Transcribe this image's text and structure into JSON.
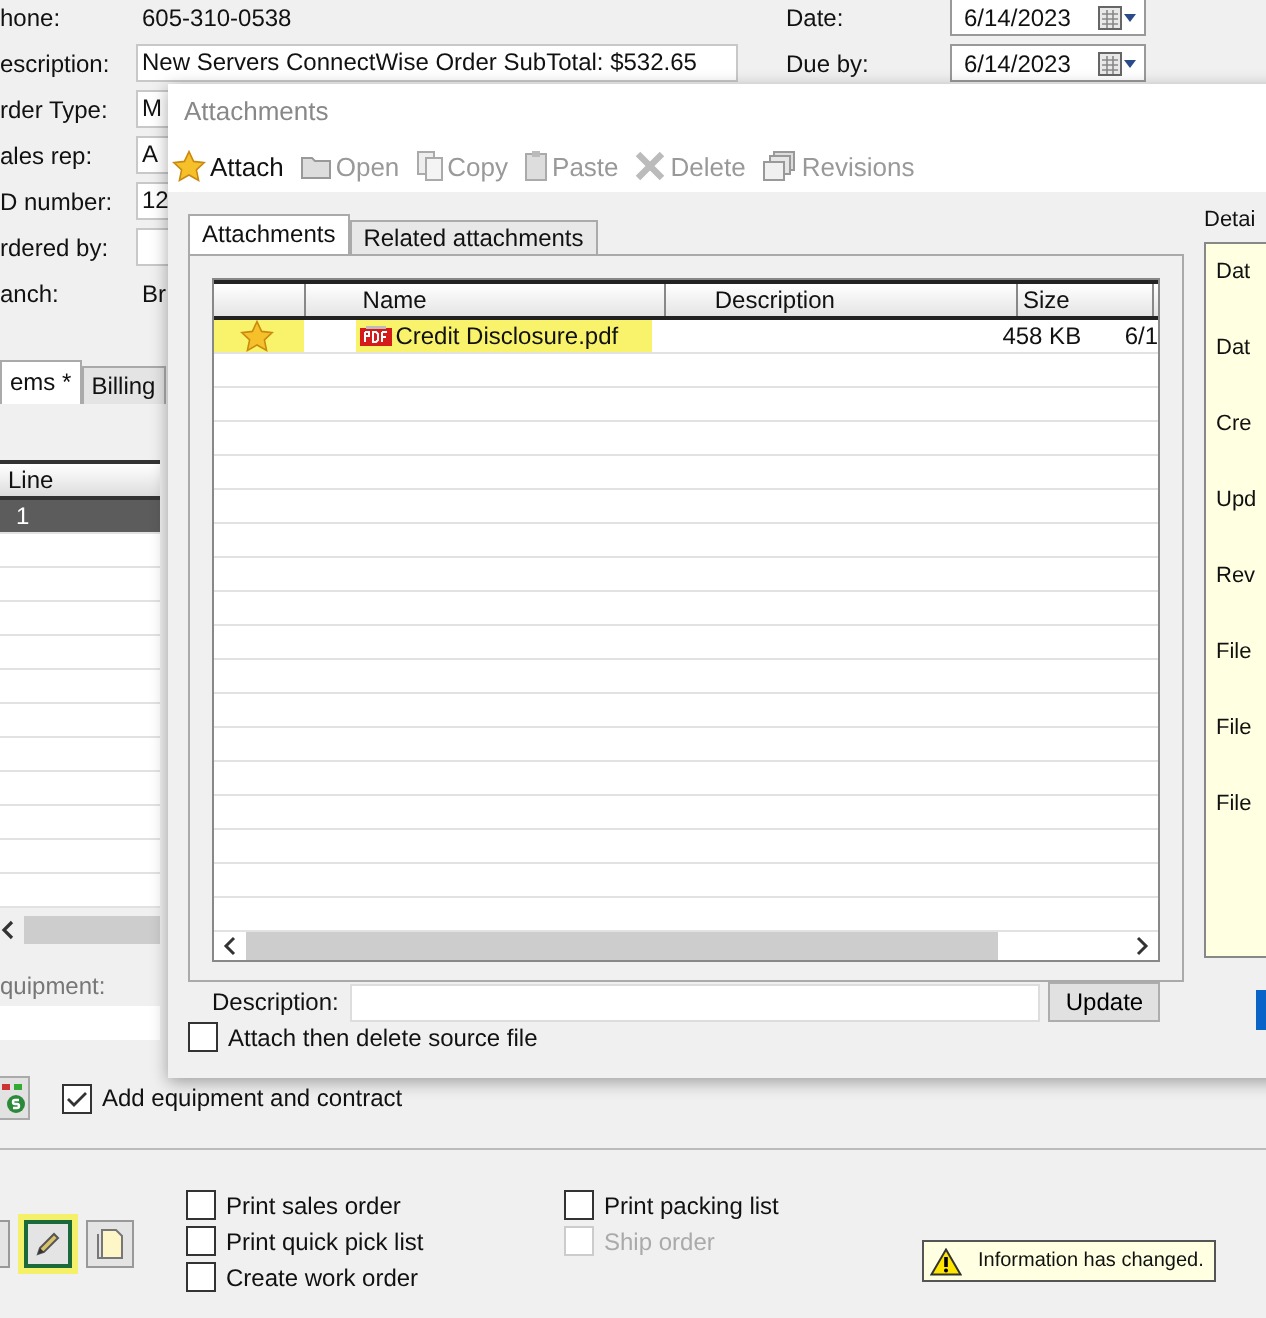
{
  "order_form": {
    "fields": [
      {
        "label": "hone:",
        "value": "605-310-0538",
        "kind": "text"
      },
      {
        "label": "escription:",
        "value": "New Servers ConnectWise Order SubTotal: $532.65",
        "kind": "field"
      },
      {
        "label": "rder Type:",
        "value": "M",
        "kind": "field"
      },
      {
        "label": "ales rep:",
        "value": "A",
        "kind": "field"
      },
      {
        "label": "D number:",
        "value": "12",
        "kind": "field"
      },
      {
        "label": "rdered by:",
        "kind": "field"
      },
      {
        "label": "anch:",
        "value": "Br",
        "kind": "text"
      }
    ],
    "dates": [
      {
        "label": "Date:",
        "value": "6/14/2023"
      },
      {
        "label": "Due by:",
        "value": "6/14/2023"
      }
    ]
  },
  "tabs": [
    {
      "label": "ems *",
      "selected": true
    },
    {
      "label": "Billing",
      "selected": false
    }
  ],
  "lines_grid": {
    "columns": [
      "Line"
    ],
    "rows": [
      {
        "line": "1",
        "selected": true
      }
    ]
  },
  "equipment": {
    "label": "quipment:"
  },
  "add_equipment": {
    "label": "Add equipment and contract",
    "checked": true
  },
  "print_options": [
    {
      "label": "Print sales order",
      "checked": false,
      "disabled": false
    },
    {
      "label": "Print quick pick list",
      "checked": false,
      "disabled": false
    },
    {
      "label": "Create work order",
      "checked": false,
      "disabled": false
    },
    {
      "label": "Print packing list",
      "checked": false,
      "disabled": false
    },
    {
      "label": "Ship order",
      "checked": false,
      "disabled": true
    }
  ],
  "attach_button": {
    "highlighted": true
  },
  "status": {
    "message": "Information has changed."
  },
  "dialog": {
    "title": "Attachments",
    "toolbar": [
      {
        "label": "Attach",
        "kind": "star",
        "disabled": false
      },
      {
        "label": "Open",
        "kind": "folder",
        "disabled": true
      },
      {
        "label": "Copy",
        "kind": "copy",
        "disabled": true
      },
      {
        "label": "Paste",
        "kind": "paste",
        "disabled": true
      },
      {
        "label": "Delete",
        "kind": "delete",
        "disabled": true
      },
      {
        "label": "Revisions",
        "kind": "revisions",
        "disabled": true
      }
    ],
    "tabs": [
      {
        "label": "Attachments",
        "selected": true
      },
      {
        "label": "Related attachments",
        "selected": false
      }
    ],
    "grid": {
      "columns": [
        "Name",
        "Description",
        "Size"
      ],
      "rows": [
        {
          "name": "Credit Disclosure.pdf",
          "size": "458 KB",
          "column_5": "6/1",
          "highlighted": true
        }
      ]
    },
    "description": {
      "label": "Description:"
    },
    "update_button": "Update",
    "delete_source": {
      "label": "Attach then delete source file",
      "checked": false
    },
    "details": {
      "title": "Detai",
      "labels": [
        "Dat",
        "Dat",
        "Cre",
        "Upd",
        "Rev",
        "File",
        "File",
        "File"
      ]
    }
  }
}
